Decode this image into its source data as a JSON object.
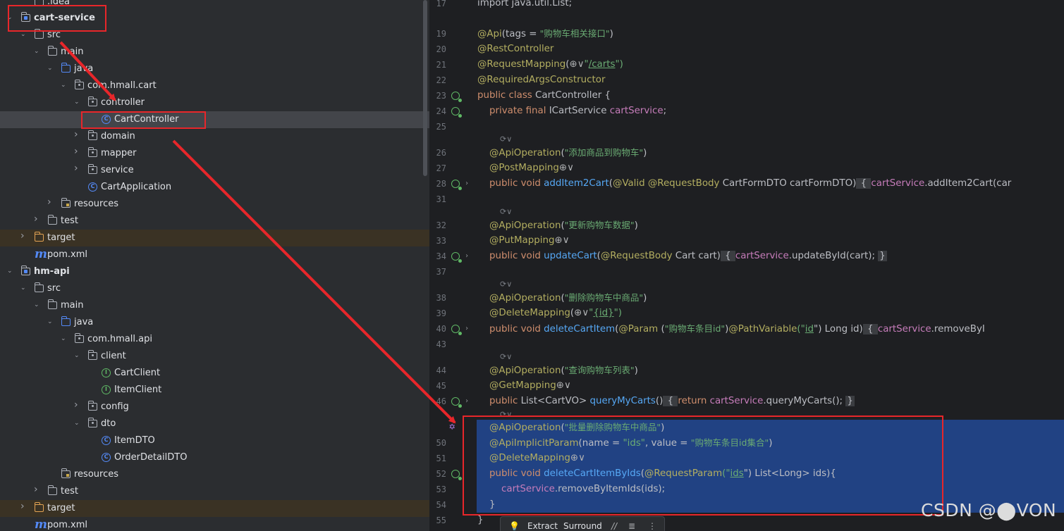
{
  "project_tree": {
    "items": [
      {
        "label": ".idea",
        "icon": "folder-icon"
      },
      {
        "label": "cart-service",
        "icon": "module-folder-icon"
      },
      {
        "label": "src",
        "icon": "folder-icon"
      },
      {
        "label": "main",
        "icon": "folder-icon"
      },
      {
        "label": "java",
        "icon": "source-folder-icon"
      },
      {
        "label": "com.hmall.cart",
        "icon": "package-icon"
      },
      {
        "label": "controller",
        "icon": "package-icon"
      },
      {
        "label": "CartController",
        "icon": "class-icon"
      },
      {
        "label": "domain",
        "icon": "package-icon"
      },
      {
        "label": "mapper",
        "icon": "package-icon"
      },
      {
        "label": "service",
        "icon": "package-icon"
      },
      {
        "label": "CartApplication",
        "icon": "spring-boot-class-icon"
      },
      {
        "label": "resources",
        "icon": "resources-folder-icon"
      },
      {
        "label": "test",
        "icon": "folder-icon"
      },
      {
        "label": "target",
        "icon": "excluded-folder-icon"
      },
      {
        "label": "pom.xml",
        "icon": "maven-icon"
      },
      {
        "label": "hm-api",
        "icon": "module-folder-icon"
      },
      {
        "label": "src",
        "icon": "folder-icon"
      },
      {
        "label": "main",
        "icon": "folder-icon"
      },
      {
        "label": "java",
        "icon": "source-folder-icon"
      },
      {
        "label": "com.hmall.api",
        "icon": "package-icon"
      },
      {
        "label": "client",
        "icon": "package-icon"
      },
      {
        "label": "CartClient",
        "icon": "interface-icon"
      },
      {
        "label": "ItemClient",
        "icon": "interface-icon"
      },
      {
        "label": "config",
        "icon": "package-icon"
      },
      {
        "label": "dto",
        "icon": "package-icon"
      },
      {
        "label": "ItemDTO",
        "icon": "class-icon"
      },
      {
        "label": "OrderDetailDTO",
        "icon": "class-icon"
      },
      {
        "label": "resources",
        "icon": "resources-folder-icon"
      },
      {
        "label": "test",
        "icon": "folder-icon"
      },
      {
        "label": "target",
        "icon": "excluded-folder-icon"
      },
      {
        "label": "pom.xml",
        "icon": "maven-icon"
      }
    ]
  },
  "editor": {
    "line_numbers": [
      "17",
      "19",
      "20",
      "21",
      "22",
      "23",
      "24",
      "25",
      "26",
      "27",
      "28",
      "31",
      "32",
      "33",
      "34",
      "37",
      "38",
      "39",
      "40",
      "43",
      "44",
      "45",
      "46",
      "50",
      "51",
      "52",
      "53",
      "54",
      "55"
    ],
    "lines": {
      "l17": "import java.util.List;",
      "l19_a": "@Api",
      "l19_b": "(tags = ",
      "l19_c": "\"购物车相关接口\"",
      "l19_d": ")",
      "l20": "@RestController",
      "l21_a": "@RequestMapping",
      "l21_b": "(",
      "l21_c": "⊕∨",
      "l21_d": "\"",
      "l21_e": "/carts",
      "l21_f": "\")",
      "l22": "@RequiredArgsConstructor",
      "l23_a": "public class ",
      "l23_b": "CartController {",
      "l24_a": "    private final ",
      "l24_b": "ICartService ",
      "l24_c": "cartService",
      "l24_d": ";",
      "l26_a": "    @ApiOperation",
      "l26_b": "(",
      "l26_c": "\"添加商品到购物车\"",
      "l26_d": ")",
      "l27_a": "    @PostMapping",
      "l27_b": "⊕∨",
      "l28_a": "    public void ",
      "l28_b": "addItem2Cart",
      "l28_c": "(",
      "l28_d": "@Valid @RequestBody ",
      "l28_e": "CartFormDTO cartFormDTO)",
      "l28_f": " { ",
      "l28_g": "cartService",
      "l28_h": ".addItem2Cart(car",
      "l32_a": "    @ApiOperation",
      "l32_b": "(",
      "l32_c": "\"更新购物车数据\"",
      "l32_d": ")",
      "l33_a": "    @PutMapping",
      "l33_b": "⊕∨",
      "l34_a": "    public void ",
      "l34_b": "updateCart",
      "l34_c": "(",
      "l34_d": "@RequestBody ",
      "l34_e": "Cart cart)",
      "l34_f": " { ",
      "l34_g": "cartService",
      "l34_h": ".updateById(cart); ",
      "l34_i": "}",
      "l38_a": "    @ApiOperation",
      "l38_b": "(",
      "l38_c": "\"删除购物车中商品\"",
      "l38_d": ")",
      "l39_a": "    @DeleteMapping",
      "l39_b": "(",
      "l39_c": "⊕∨",
      "l39_d": "\"",
      "l39_e": "{id}",
      "l39_f": "\")",
      "l40_a": "    public void ",
      "l40_b": "deleteCartItem",
      "l40_c": "(",
      "l40_d": "@Param ",
      "l40_e": "(",
      "l40_f": "\"购物车条目id\"",
      "l40_g": ")",
      "l40_h": "@PathVariable",
      "l40_i": "(\"",
      "l40_j": "id",
      "l40_k": "\") Long id)",
      "l40_l": " { ",
      "l40_m": "cartService",
      "l40_n": ".removeByI",
      "l44_a": "    @ApiOperation",
      "l44_b": "(",
      "l44_c": "\"查询购物车列表\"",
      "l44_d": ")",
      "l45_a": "    @GetMapping",
      "l45_b": "⊕∨",
      "l46_a": "    public ",
      "l46_b": "List<CartVO> ",
      "l46_c": "queryMyCarts",
      "l46_d": "()",
      "l46_e": " { ",
      "l46_f": "return ",
      "l46_g": "cartService",
      "l46_h": ".queryMyCarts(); ",
      "l46_i": "}",
      "l49_a": "    @ApiOperation",
      "l49_b": "(",
      "l49_c": "\"批量删除购物车中商品\"",
      "l49_d": ")",
      "l50_a": "    @ApiImplicitParam",
      "l50_b": "(name = ",
      "l50_c": "\"ids\"",
      "l50_d": ", value = ",
      "l50_e": "\"购物车条目id集合\"",
      "l50_f": ")",
      "l51_a": "    @DeleteMapping",
      "l51_b": "⊕∨",
      "l52_a": "    public void ",
      "l52_b": "deleteCartItemByIds",
      "l52_c": "(",
      "l52_d": "@RequestParam",
      "l52_e": "(\"",
      "l52_f": "ids",
      "l52_g": "\") List<Long> ids){",
      "l53_a": "        cartService",
      "l53_b": ".removeByItemIds(ids);",
      "l54": "    }",
      "l55": "}"
    },
    "inlay_hint": "⟳∨"
  },
  "floating_toolbar": {
    "extract_label": "Extract",
    "surround_label": "Surround",
    "comment_icon": "//",
    "format_icon": "≣",
    "more_icon": "⋮"
  },
  "watermark": "CSDN @⬤VON",
  "colors": {
    "annotation_red": "#e8262a",
    "selection_blue": "#214283"
  }
}
